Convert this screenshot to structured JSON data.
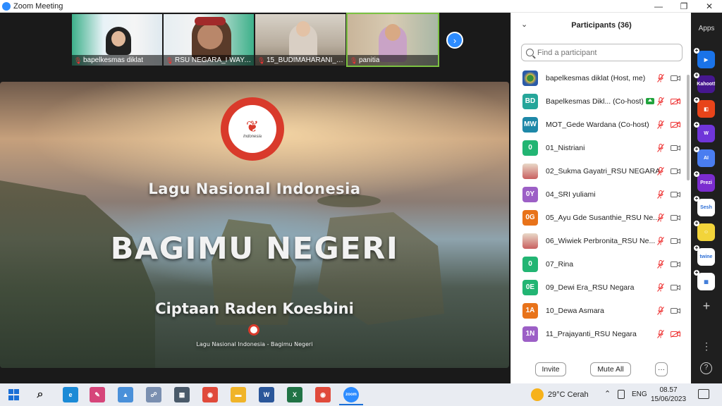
{
  "window": {
    "title": "Zoom Meeting",
    "controls": [
      "minimize",
      "restore",
      "close"
    ]
  },
  "gallery": {
    "thumbnails": [
      {
        "name": "bapelkesmas diklat",
        "muted": true,
        "active": false
      },
      {
        "name": "RSU NEGARA_I WAYA...",
        "muted": true,
        "active": false
      },
      {
        "name": "15_BUDIMAHARANI_R...",
        "muted": true,
        "active": false
      },
      {
        "name": "panitia",
        "muted": true,
        "active": true
      }
    ],
    "next_icon": "chevron-right-icon"
  },
  "shared_screen": {
    "subtitle": "Lagu Nasional Indonesia",
    "title": "BAGIMU NEGERI",
    "composer": "Ciptaan Raden Koesbini",
    "caption": "Lagu Nasional Indonesia - Bagimu Negeri",
    "logo_wordmark": "Indonesia"
  },
  "participants": {
    "title": "Participants (36)",
    "search_placeholder": "Find a participant",
    "list": [
      {
        "initials": "",
        "avatar": "logo",
        "color": "",
        "name": "bapelkesmas diklat (Host, me)",
        "share_badge": false,
        "video_off": false
      },
      {
        "initials": "BD",
        "avatar": "initials",
        "color": "#26a69a",
        "name": "Bapelkesmas Dikl... (Co-host)",
        "share_badge": true,
        "video_off": true
      },
      {
        "initials": "MW",
        "avatar": "initials",
        "color": "#1e88a8",
        "name": "MOT_Gede Wardana (Co-host)",
        "share_badge": false,
        "video_off": true
      },
      {
        "initials": "0",
        "avatar": "initials",
        "color": "#22b573",
        "name": "01_Nistriani",
        "share_badge": false,
        "video_off": false
      },
      {
        "initials": "",
        "avatar": "photo",
        "color": "",
        "name": "02_Sukma Gayatri_RSU NEGARA",
        "share_badge": false,
        "video_off": false
      },
      {
        "initials": "0Y",
        "avatar": "initials",
        "color": "#9c5fc6",
        "name": "04_SRI yuliami",
        "share_badge": false,
        "video_off": false
      },
      {
        "initials": "0G",
        "avatar": "initials",
        "color": "#e8731a",
        "name": "05_Ayu Gde Susanthie_RSU Ne...",
        "share_badge": false,
        "video_off": false
      },
      {
        "initials": "",
        "avatar": "photo",
        "color": "",
        "name": "06_Wiwiek Perbronita_RSU Ne...",
        "share_badge": false,
        "video_off": false
      },
      {
        "initials": "0",
        "avatar": "initials",
        "color": "#22b573",
        "name": "07_Rina",
        "share_badge": false,
        "video_off": false
      },
      {
        "initials": "0E",
        "avatar": "initials",
        "color": "#22b573",
        "name": "09_Dewi Era_RSU Negara",
        "share_badge": false,
        "video_off": false
      },
      {
        "initials": "1A",
        "avatar": "initials",
        "color": "#e8731a",
        "name": "10_Dewa Asmara",
        "share_badge": false,
        "video_off": false
      },
      {
        "initials": "1N",
        "avatar": "initials",
        "color": "#9c5fc6",
        "name": "11_Prajayanti_RSU Negara",
        "share_badge": false,
        "video_off": true
      }
    ],
    "invite_label": "Invite",
    "mute_all_label": "Mute All",
    "more_label": "···"
  },
  "apps_panel": {
    "label": "Apps",
    "apps": [
      {
        "name": "zoom-app-icon",
        "color": "#1a73e8",
        "text": "▶"
      },
      {
        "name": "kahoot-icon",
        "color": "#46178f",
        "text": "Kahoot!"
      },
      {
        "name": "app-red-icon",
        "color": "#e8441a",
        "text": "◧"
      },
      {
        "name": "wooclap-icon",
        "color": "#6f35d9",
        "text": "W"
      },
      {
        "name": "ai-app-icon",
        "color": "#4a7df0",
        "text": "AI"
      },
      {
        "name": "prezi-icon",
        "color": "#7b2ccf",
        "text": "Prezi"
      },
      {
        "name": "sesh-icon",
        "color": "#ffffff",
        "text": "Sesh"
      },
      {
        "name": "emoji-app-icon",
        "color": "#f2d43a",
        "text": "☺"
      },
      {
        "name": "twine-icon",
        "color": "#ffffff",
        "text": "twine"
      },
      {
        "name": "grid-app-icon",
        "color": "#ffffff",
        "text": "▦"
      }
    ],
    "help_label": "?"
  },
  "taskbar": {
    "weather_temp": "29°C",
    "weather_desc": "Cerah",
    "language": "ENG",
    "time": "08.57",
    "date": "15/06/2023",
    "pinned": [
      {
        "name": "edge-icon",
        "color": "#1b8ad6",
        "text": "e"
      },
      {
        "name": "paint-icon",
        "color": "#d6457a",
        "text": "✎"
      },
      {
        "name": "app-blue-icon",
        "color": "#4a90d9",
        "text": "▲"
      },
      {
        "name": "network-icon",
        "color": "#7a8fb0",
        "text": "☍"
      },
      {
        "name": "calculator-icon",
        "color": "#4a5a6a",
        "text": "▦"
      },
      {
        "name": "chrome-icon",
        "color": "#e04a3b",
        "text": "◉"
      },
      {
        "name": "file-explorer-icon",
        "color": "#f0b429",
        "text": "▬"
      },
      {
        "name": "word-icon",
        "color": "#2b579a",
        "text": "W"
      },
      {
        "name": "excel-icon",
        "color": "#217346",
        "text": "X"
      },
      {
        "name": "chrome-icon-2",
        "color": "#e04a3b",
        "text": "◉"
      },
      {
        "name": "zoom-taskbar-icon",
        "color": "#2d8cff",
        "text": "zoom"
      }
    ]
  }
}
